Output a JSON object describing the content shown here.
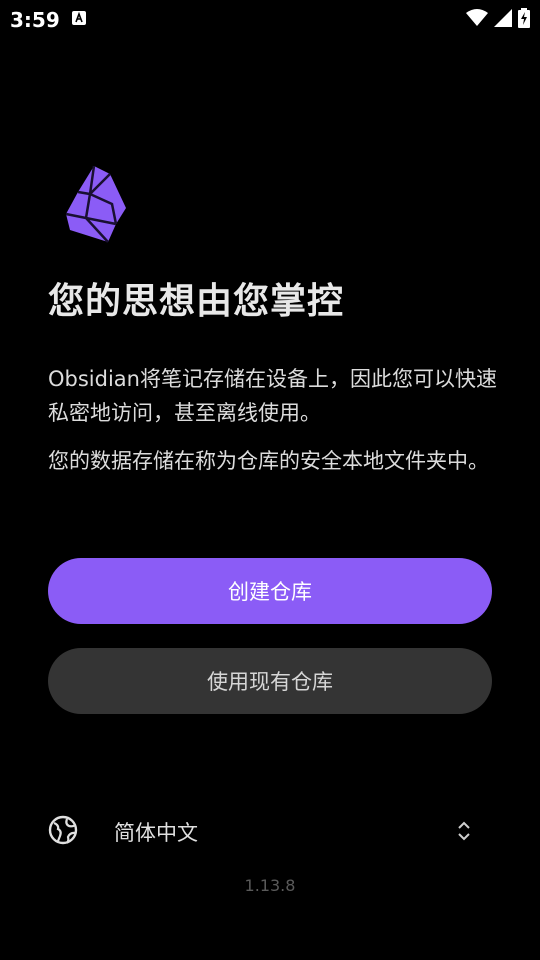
{
  "status_bar": {
    "time": "3:59",
    "notification_icon": "text-a-icon",
    "icons": [
      "wifi-icon",
      "signal-icon",
      "battery-charging-icon"
    ]
  },
  "logo_icon": "obsidian-crystal-icon",
  "title": "您的思想由您掌控",
  "paragraphs": {
    "first": "Obsidian将笔记存储在设备上，因此您可以快速私密地访问，甚至离线使用。",
    "second": "您的数据存储在称为仓库的安全本地文件夹中。"
  },
  "buttons": {
    "create_vault": "创建仓库",
    "use_existing_vault": "使用现有仓库"
  },
  "language": {
    "icon": "globe-icon",
    "selected": "简体中文",
    "chevron_icon": "chevron-up-down-icon"
  },
  "version": "1.13.8",
  "colors": {
    "background": "#000000",
    "accent": "#8b5cf6",
    "secondary_button": "#343434"
  }
}
